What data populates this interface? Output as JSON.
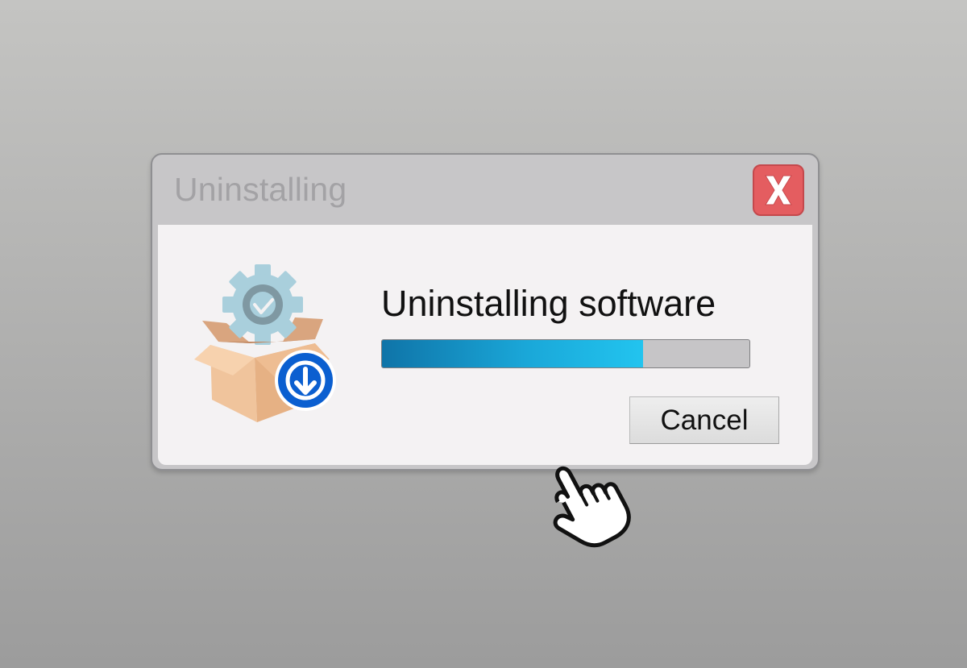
{
  "window": {
    "title": "Uninstalling",
    "close_icon": "close-x-icon"
  },
  "main": {
    "heading": "Uninstalling software",
    "progress": 0.71,
    "cancel_label": "Cancel",
    "illustration_icon": "package-gear-download-icon"
  },
  "colors": {
    "close_button": "#e45d60",
    "progress_fill_start": "#0f74a8",
    "progress_fill_end": "#22c4ef",
    "progress_track": "#c6c5c7",
    "download_badge": "#0b5fd0"
  },
  "cursor": {
    "icon": "hand-pointer-icon"
  }
}
